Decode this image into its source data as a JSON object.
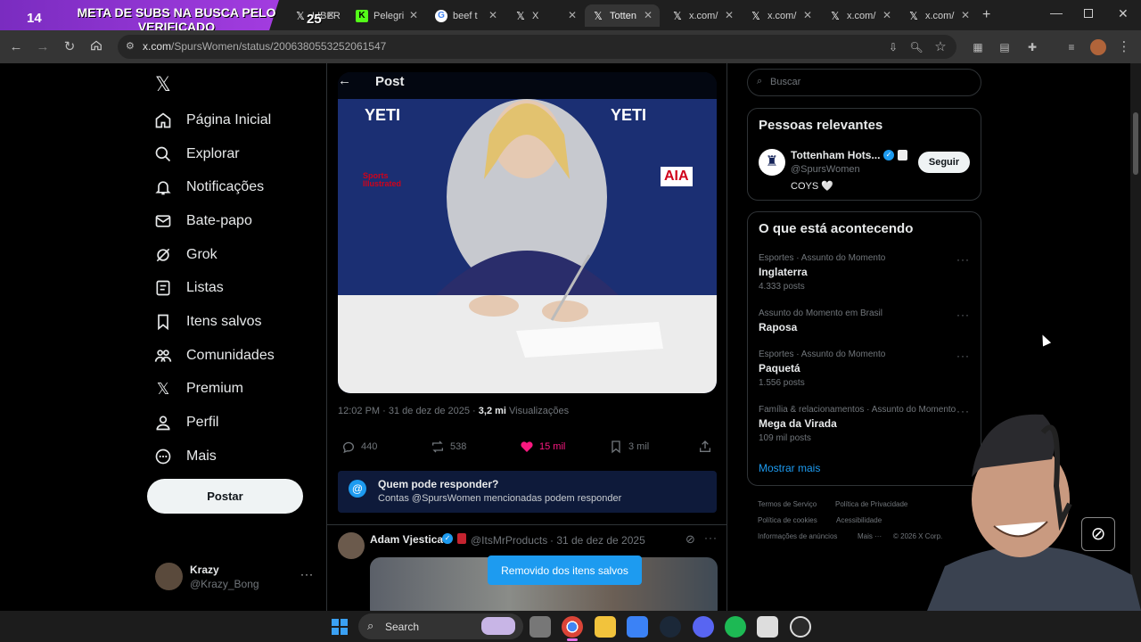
{
  "overlay": {
    "counter": "14",
    "banner_text": "META DE SUBS NA BUSCA PELO VERIFICADO",
    "counter2": "25"
  },
  "browser": {
    "tabs": [
      {
        "label": "LIBER",
        "icon": "x-icon"
      },
      {
        "label": "Pelegri",
        "icon": "kick-icon"
      },
      {
        "label": "beef t",
        "icon": "google-icon"
      },
      {
        "label": "X",
        "icon": "x-icon"
      },
      {
        "label": "Totten",
        "icon": "x-icon",
        "active": true
      },
      {
        "label": "x.com/",
        "icon": "x-icon"
      },
      {
        "label": "x.com/",
        "icon": "x-icon"
      },
      {
        "label": "x.com/",
        "icon": "x-icon"
      },
      {
        "label": "x.com/",
        "icon": "x-icon"
      }
    ],
    "url_host": "x.com",
    "url_path": "/SpursWomen/status/2006380553252061547"
  },
  "nav": {
    "items": [
      {
        "label": "Página Inicial",
        "icon": "home-icon"
      },
      {
        "label": "Explorar",
        "icon": "search-icon"
      },
      {
        "label": "Notificações",
        "icon": "bell-icon"
      },
      {
        "label": "Bate-papo",
        "icon": "mail-icon"
      },
      {
        "label": "Grok",
        "icon": "grok-icon"
      },
      {
        "label": "Listas",
        "icon": "list-icon"
      },
      {
        "label": "Itens salvos",
        "icon": "bookmark-icon"
      },
      {
        "label": "Comunidades",
        "icon": "people-icon"
      },
      {
        "label": "Premium",
        "icon": "x-icon"
      },
      {
        "label": "Perfil",
        "icon": "person-icon"
      },
      {
        "label": "Mais",
        "icon": "more-circle-icon"
      }
    ],
    "post_button": "Postar",
    "account": {
      "name": "Krazy",
      "handle": "@Krazy_Bong"
    }
  },
  "post": {
    "header_title": "Post",
    "time": "12:02 PM · 31 de dez de 2025 · ",
    "views_count": "3,2 mi",
    "views_label": " Visualizações",
    "replies": "440",
    "reposts": "538",
    "likes": "15 mil",
    "bookmarks": "3 mil",
    "reply_title": "Quem pode responder?",
    "reply_desc": "Contas @SpursWomen mencionadas podem responder",
    "media_texts": {
      "brand1": "YETI",
      "brand2": "YETI",
      "sponsor": "AIA",
      "sports": "Sports Illustrated"
    }
  },
  "reply": {
    "name": "Adam Vjestica",
    "handle": "@ItsMrProducts",
    "date": "· 31 de dez de 2025"
  },
  "toast": "Removido dos itens salvos",
  "sidebar": {
    "search_placeholder": "Buscar",
    "relevant_title": "Pessoas relevantes",
    "relevant": {
      "name": "Tottenham Hots...",
      "handle": "@SpursWomen",
      "bio": "COYS 🤍",
      "follow": "Seguir"
    },
    "trends_title": "O que está acontecendo",
    "trends": [
      {
        "category": "Esportes · Assunto do Momento",
        "name": "Inglaterra",
        "count": "4.333 posts"
      },
      {
        "category": "Assunto do Momento em Brasil",
        "name": "Raposa",
        "count": ""
      },
      {
        "category": "Esportes · Assunto do Momento",
        "name": "Paquetá",
        "count": "1.556 posts"
      },
      {
        "category": "Família & relacionamentos · Assunto do Momento",
        "name": "Mega da Virada",
        "count": "109 mil posts"
      }
    ],
    "show_more": "Mostrar mais",
    "footer": [
      "Termos de Serviço",
      "Política de Privacidade",
      "Política de cookies",
      "Acessibilidade",
      "Informações de anúncios",
      "Mais ···",
      "© 2026 X Corp."
    ]
  },
  "taskbar": {
    "search": "Search"
  },
  "colors": {
    "accent": "#1d9bf0",
    "like": "#f91880",
    "banner": "#a33ce0"
  }
}
